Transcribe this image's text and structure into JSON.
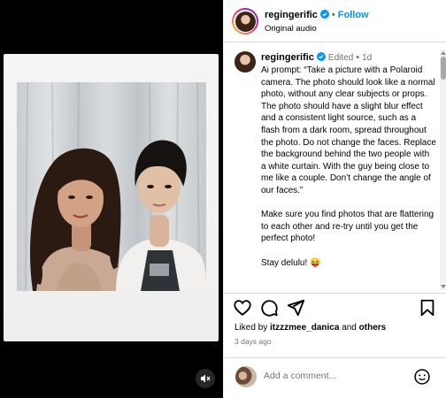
{
  "header": {
    "username": "regingerific",
    "separator": "•",
    "follow_label": "Follow",
    "subtitle": "Original audio"
  },
  "post": {
    "username": "regingerific",
    "edited_label": "Edited",
    "separator": "•",
    "age": "1d",
    "caption_paragraphs": [
      "Ai prompt: “Take a picture with a Polaroid camera. The photo should look like a normal photo, without any clear subjects or props. The photo should have a slight blur effect and a consistent light source, such as a flash from a dark room, spread throughout the photo. Do not change the faces. Replace the background behind the two people with a white curtain. With the guy being close to me like a couple. Don’t change the angle of our faces.”",
      "Make sure you find photos that are flattering to each other and re-try until you get the perfect photo!",
      "Stay delulu! 😝"
    ]
  },
  "likes": {
    "prefix": "Liked by",
    "user": "itzzzmee_danica",
    "conjunction": "and",
    "others": "others"
  },
  "timestamp": "3 days ago",
  "comment_box": {
    "placeholder": "Add a comment..."
  },
  "icons": {
    "verified": "verified-badge-icon",
    "mute": "speaker-muted-icon",
    "like": "heart-icon",
    "comment": "comment-bubble-icon",
    "share": "paper-plane-icon",
    "save": "bookmark-icon",
    "emoji": "emoji-smiley-icon"
  },
  "colors": {
    "accent": "#0095f6",
    "muted_text": "#737373",
    "media_background": "#000000"
  }
}
